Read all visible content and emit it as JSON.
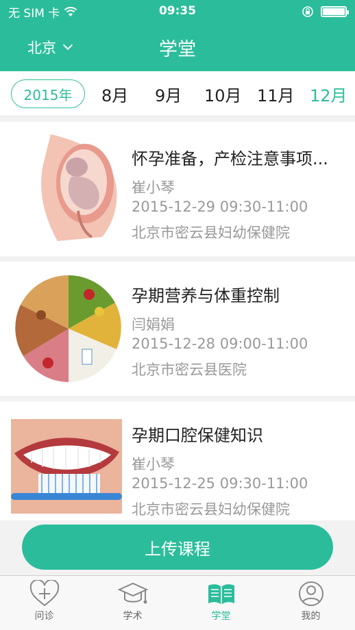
{
  "status_bar": {
    "carrier": "无 SIM 卡",
    "time": "09:35"
  },
  "nav": {
    "city": "北京",
    "title": "学堂"
  },
  "month_selector": {
    "year": "2015年",
    "months": [
      "8月",
      "9月",
      "10月",
      "11月",
      "12月"
    ],
    "active_month": "12月"
  },
  "courses": [
    {
      "title": "怀孕准备，产检注意事项...",
      "speaker": "崔小琴",
      "time": "2015-12-29 09:30-11:00",
      "location": "北京市密云县妇幼保健院",
      "image": "pregnancy-illustration"
    },
    {
      "title": "孕期营养与体重控制",
      "speaker": "闫娟娟",
      "time": "2015-12-28 09:00-11:00",
      "location": "北京市密云县医院",
      "image": "food-pyramid"
    },
    {
      "title": "孕期口腔保健知识",
      "speaker": "崔小琴",
      "time": "2015-12-25 09:30-11:00",
      "location": "北京市密云县妇幼保健院",
      "image": "smile-toothbrush"
    }
  ],
  "upload_button": "上传课程",
  "tabs": [
    {
      "label": "问诊",
      "icon": "heart-plus-icon"
    },
    {
      "label": "学术",
      "icon": "graduation-cap-icon"
    },
    {
      "label": "学堂",
      "icon": "book-icon"
    },
    {
      "label": "我的",
      "icon": "user-icon"
    }
  ],
  "colors": {
    "primary": "#2bbd9b",
    "text": "#222222",
    "secondary_text": "#999999",
    "background": "#f2f2f2"
  }
}
